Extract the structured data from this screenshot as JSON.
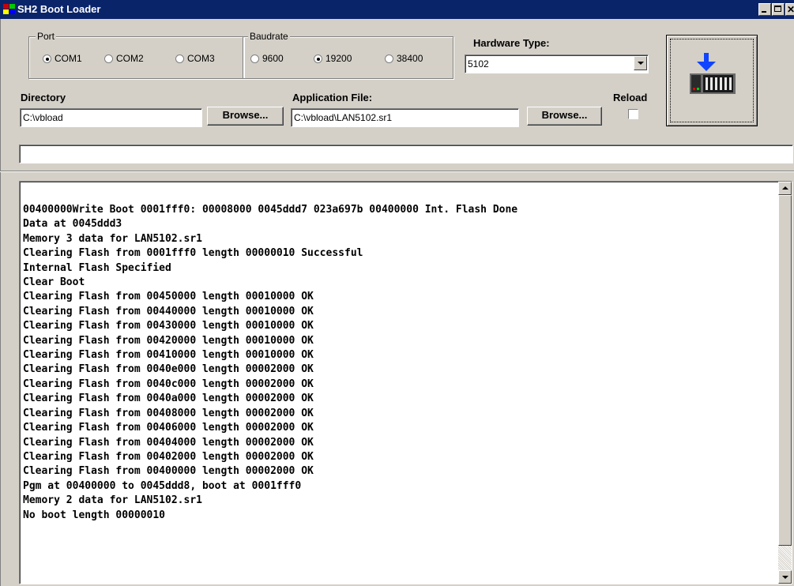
{
  "window": {
    "title": "SH2 Boot Loader"
  },
  "port": {
    "legend": "Port",
    "options": [
      "COM1",
      "COM2",
      "COM3"
    ],
    "selected": "COM1"
  },
  "baudrate": {
    "legend": "Baudrate",
    "options": [
      "9600",
      "19200",
      "38400"
    ],
    "selected": "19200"
  },
  "hardware_type": {
    "label": "Hardware Type:",
    "value": "5102"
  },
  "directory": {
    "label": "Directory",
    "value": "C:\\vbload",
    "browse_label": "Browse..."
  },
  "application_file": {
    "label": "Application File:",
    "value": "C:\\vbload\\LAN5102.sr1",
    "browse_label": "Browse..."
  },
  "reload": {
    "label": "Reload",
    "checked": false
  },
  "load_button": {
    "icon": "download-to-device-icon"
  },
  "status_field": {
    "value": ""
  },
  "log": {
    "lines": [
      "00400000Write Boot 0001fff0: 00008000 0045ddd7 023a697b 00400000 Int. Flash Done",
      "Data at 0045ddd3",
      "Memory 3 data for LAN5102.sr1",
      "Clearing Flash from 0001fff0 length 00000010 Successful",
      "Internal Flash Specified",
      "Clear Boot",
      "Clearing Flash from 00450000 length 00010000 OK",
      "Clearing Flash from 00440000 length 00010000 OK",
      "Clearing Flash from 00430000 length 00010000 OK",
      "Clearing Flash from 00420000 length 00010000 OK",
      "Clearing Flash from 00410000 length 00010000 OK",
      "Clearing Flash from 0040e000 length 00002000 OK",
      "Clearing Flash from 0040c000 length 00002000 OK",
      "Clearing Flash from 0040a000 length 00002000 OK",
      "Clearing Flash from 00408000 length 00002000 OK",
      "Clearing Flash from 00406000 length 00002000 OK",
      "Clearing Flash from 00404000 length 00002000 OK",
      "Clearing Flash from 00402000 length 00002000 OK",
      "Clearing Flash from 00400000 length 00002000 OK",
      "Pgm at 00400000 to 0045ddd8, boot at 0001fff0",
      "Memory 2 data for LAN5102.sr1",
      "No boot length 00000010"
    ]
  }
}
